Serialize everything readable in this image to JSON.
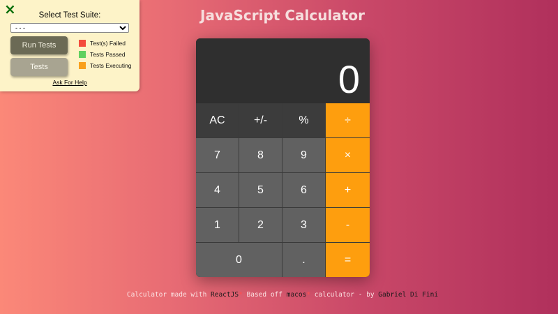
{
  "test_panel": {
    "close_icon": "×",
    "title": "Select Test Suite:",
    "select_value": "- - -",
    "run_button": "Run Tests",
    "tests_button": "Tests",
    "legend": [
      {
        "label": "Test(s) Failed",
        "color": "#f44b3c"
      },
      {
        "label": "Tests Passed",
        "color": "#5fd05f"
      },
      {
        "label": "Tests Executing",
        "color": "#f9a01b"
      }
    ],
    "help_link": "Ask For Help"
  },
  "page": {
    "title": "JavaScript Calculator"
  },
  "calculator": {
    "display": "0",
    "keys": {
      "ac": "AC",
      "sign": "+/-",
      "percent": "%",
      "divide": "÷",
      "seven": "7",
      "eight": "8",
      "nine": "9",
      "multiply": "×",
      "four": "4",
      "five": "5",
      "six": "6",
      "add": "+",
      "one": "1",
      "two": "2",
      "three": "3",
      "subtract": "-",
      "zero": "0",
      "decimal": ".",
      "equals": "="
    },
    "colors": {
      "operator": "#fe9e0e",
      "function": "#3c3c3c",
      "number": "#616161",
      "display_bg": "#2f2f2f"
    }
  },
  "footer": {
    "prefix": "Calculator made with ",
    "react": "ReactJS",
    "mark1": "*",
    "middle": " Based off ",
    "macos": "macos",
    "mark2": "*",
    "suffix": " calculator - by ",
    "author": "Gabriel Di Fini"
  }
}
